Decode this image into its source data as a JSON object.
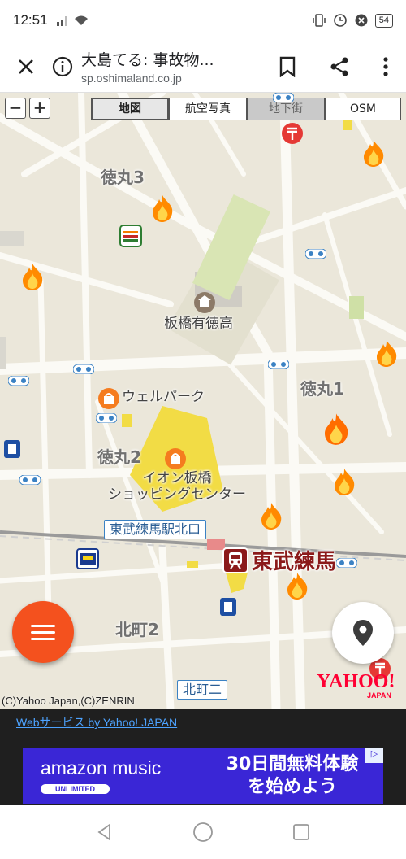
{
  "status": {
    "time": "12:51",
    "battery": "54"
  },
  "toolbar": {
    "title": "大島てる: 事故物...",
    "domain": "sp.oshimaland.co.jp"
  },
  "map": {
    "zoom_out": "−",
    "zoom_in": "+",
    "tabs": [
      "地図",
      "航空写真",
      "地下街",
      "OSM"
    ],
    "active_tab": "地図",
    "areas": {
      "tokumaru3": "徳丸3",
      "tokumaru1": "徳丸1",
      "tokumaru2": "徳丸2",
      "kitamachi2": "北町2"
    },
    "pois": {
      "school": "板橋有徳高",
      "welpark": "ウェルパーク",
      "aeon_line1": "イオン板橋",
      "aeon_line2": "ショッピングセンター"
    },
    "station_exit": "東武練馬駅北口",
    "station": "東武練馬",
    "kitamachi_sign": "北町二",
    "copyright": "(C)Yahoo Japan,(C)ZENRIN",
    "yahoo_logo": "YAHOO!",
    "yahoo_sub": "JAPAN"
  },
  "footer": {
    "web_service": "Webサービス by Yahoo! JAPAN",
    "ad": {
      "brand": "amazon music",
      "badge": "UNLIMITED",
      "line1": "30日間無料体験",
      "line2": "を始めよう"
    }
  },
  "colors": {
    "fab": "#f4511e",
    "station": "#8b1a1a",
    "ad": "#3a26d6",
    "map": "#ebe7da"
  }
}
